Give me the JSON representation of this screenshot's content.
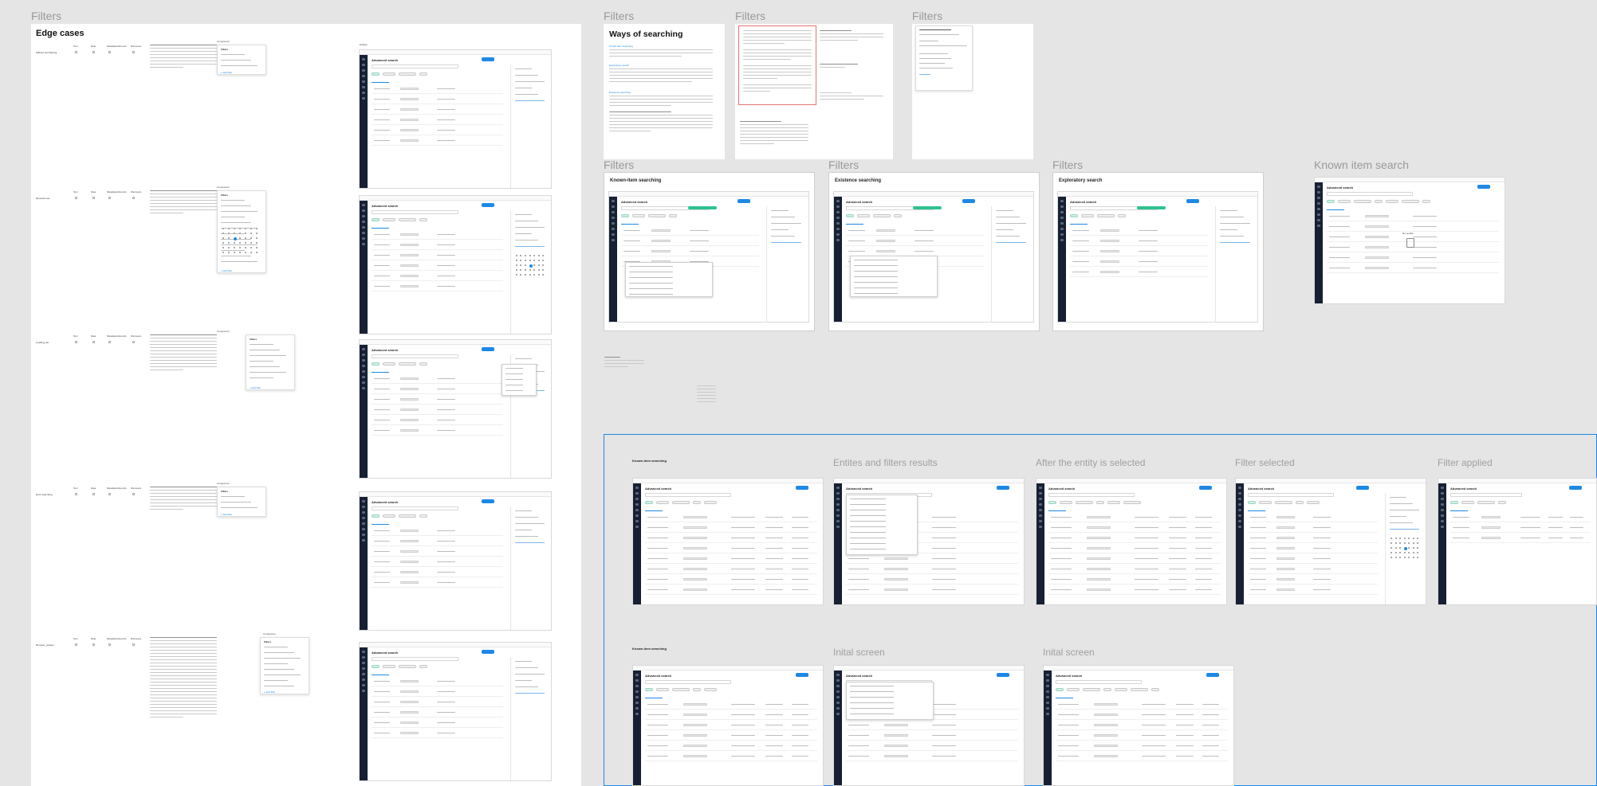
{
  "canvas": {
    "background": "#e5e5e5",
    "accent": "#1e88e5",
    "dark_rail": "#172033",
    "success": "#2ec28f"
  },
  "labels": {
    "filters_main": "Filters",
    "filters_2": "Filters",
    "filters_3": "Filters",
    "filters_4": "Filters",
    "filters_5": "Filters",
    "filters_6": "Filters",
    "filters_7": "Filters",
    "known_item_search": "Known item search",
    "entities_filters_results": "Entites and filters results",
    "after_entity_selected": "After the entity is selected",
    "filter_selected": "Filter selected",
    "filter_applied": "Filter applied",
    "inital_screen_1": "Inital screen",
    "inital_screen_2": "Inital screen"
  },
  "edge_cases": {
    "title": "Edge cases",
    "rows": [
      {
        "name": "Without text filtering",
        "cols": [
          "Text",
          "Date",
          "Metadata Records",
          "Discovers"
        ],
        "component": "Component",
        "popup_title": "Filters",
        "popup_link": "+ Add filter"
      },
      {
        "name": "Dynamic text",
        "cols": [
          "Text",
          "Date",
          "Metadata Records",
          "Discovers"
        ],
        "component": "Component",
        "popup_title": "Filters",
        "popup_link": "+ Add filter"
      },
      {
        "name": "Loading_list",
        "cols": [
          "Text",
          "Date",
          "Metadata Records",
          "Discovers"
        ],
        "component": "Component",
        "popup_title": "Filters",
        "popup_link": "+ Add filter"
      },
      {
        "name": "Error searching",
        "cols": [
          "Text",
          "Date",
          "Metadata Records",
          "Discovers"
        ],
        "component": "Component",
        "popup_title": "Filters",
        "popup_link": "+ Add filter"
      },
      {
        "name": "Remove_content",
        "cols": [
          "Text",
          "Date",
          "Metadata Records",
          "Discovers"
        ],
        "component": "Component",
        "popup_title": "Filters",
        "popup_link": "+ Add filter"
      }
    ],
    "col_header_right": "Entities"
  },
  "ways": {
    "title": "Ways of searching",
    "sub1": "Known-item searching",
    "sub2": "Exploratory search",
    "sub3": "Existence searching"
  },
  "flows": {
    "known_item": "Known-item searching",
    "existence": "Existence searching",
    "exploratory": "Exploratory search",
    "mini_title": "Advanced search",
    "known_flow_a": "Known-item searching",
    "known_flow_b": "Known-item searching"
  },
  "mini": {
    "empty_label": "No results"
  }
}
